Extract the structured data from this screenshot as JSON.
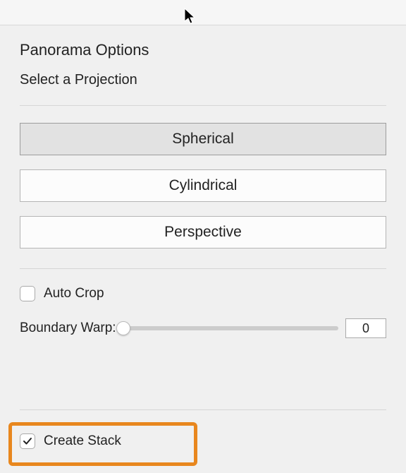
{
  "title": "Panorama Options",
  "subtitle": "Select a Projection",
  "projections": [
    {
      "label": "Spherical",
      "selected": true
    },
    {
      "label": "Cylindrical",
      "selected": false
    },
    {
      "label": "Perspective",
      "selected": false
    }
  ],
  "autoCrop": {
    "label": "Auto Crop",
    "checked": false
  },
  "boundaryWarp": {
    "label": "Boundary Warp:",
    "value": "0"
  },
  "createStack": {
    "label": "Create Stack",
    "checked": true
  }
}
